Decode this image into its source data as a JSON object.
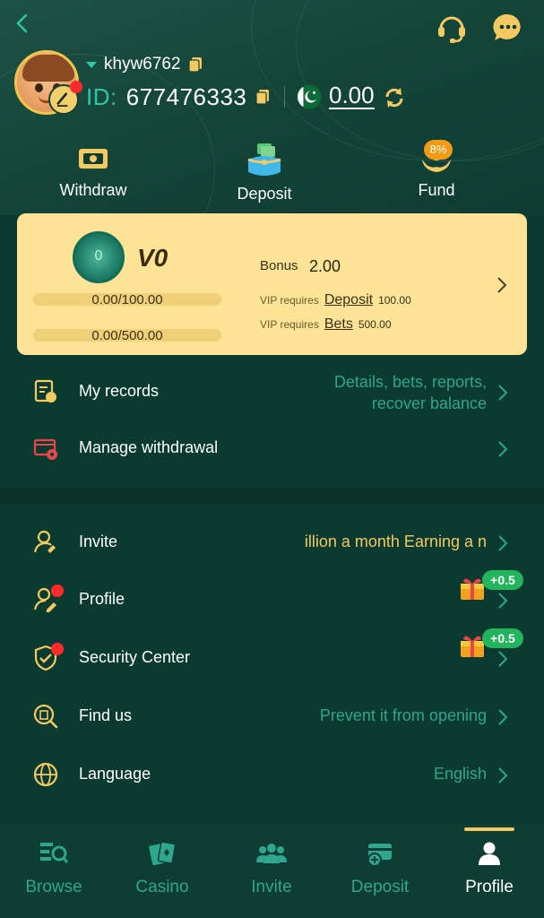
{
  "header": {
    "username": "khyw6762",
    "id_label": "ID:",
    "id_value": "677476333",
    "balance": "0.00"
  },
  "quick_actions": [
    {
      "label": "Withdraw",
      "icon": "withdraw-icon"
    },
    {
      "label": "Deposit",
      "icon": "wallet-icon"
    },
    {
      "label": "Fund",
      "icon": "fund-icon",
      "badge": "8%"
    }
  ],
  "vip": {
    "medal_level": "0",
    "level": "V0",
    "progress_deposit": "0.00/100.00",
    "progress_bets": "0.00/500.00",
    "bonus_label": "Bonus",
    "bonus_value": "2.00",
    "req_deposit_prefix": "VIP requires",
    "req_deposit_link": "Deposit",
    "req_deposit_value": "100.00",
    "req_bets_prefix": "VIP requires",
    "req_bets_link": "Bets",
    "req_bets_value": "500.00"
  },
  "menu_top": [
    {
      "label": "My records",
      "right": "Details, bets, reports,",
      "right2": "recover balance"
    },
    {
      "label": "Manage withdrawal",
      "right": ""
    }
  ],
  "menu": [
    {
      "label": "Invite",
      "right": "illion a month  Earning a n"
    },
    {
      "label": "Profile",
      "badge": "+0.5"
    },
    {
      "label": "Security Center",
      "badge": "+0.5"
    },
    {
      "label": "Find us",
      "right": "Prevent it from opening"
    },
    {
      "label": "Language",
      "right": "English"
    }
  ],
  "tabs": [
    {
      "label": "Browse",
      "icon": "browse-icon"
    },
    {
      "label": "Casino",
      "icon": "cards-icon"
    },
    {
      "label": "Invite",
      "icon": "people-icon"
    },
    {
      "label": "Deposit",
      "icon": "deposit-icon"
    },
    {
      "label": "Profile",
      "icon": "person-icon",
      "active": true
    }
  ],
  "colors": {
    "background": "#0b3a31",
    "accent_teal": "#2fc6a8",
    "gold": "#f3c961",
    "vip_card": "#fde396",
    "badge_green": "#23b45e",
    "badge_orange": "#f29a14",
    "notification_red": "#ff2a2a",
    "invite_text": "#f3c961"
  }
}
